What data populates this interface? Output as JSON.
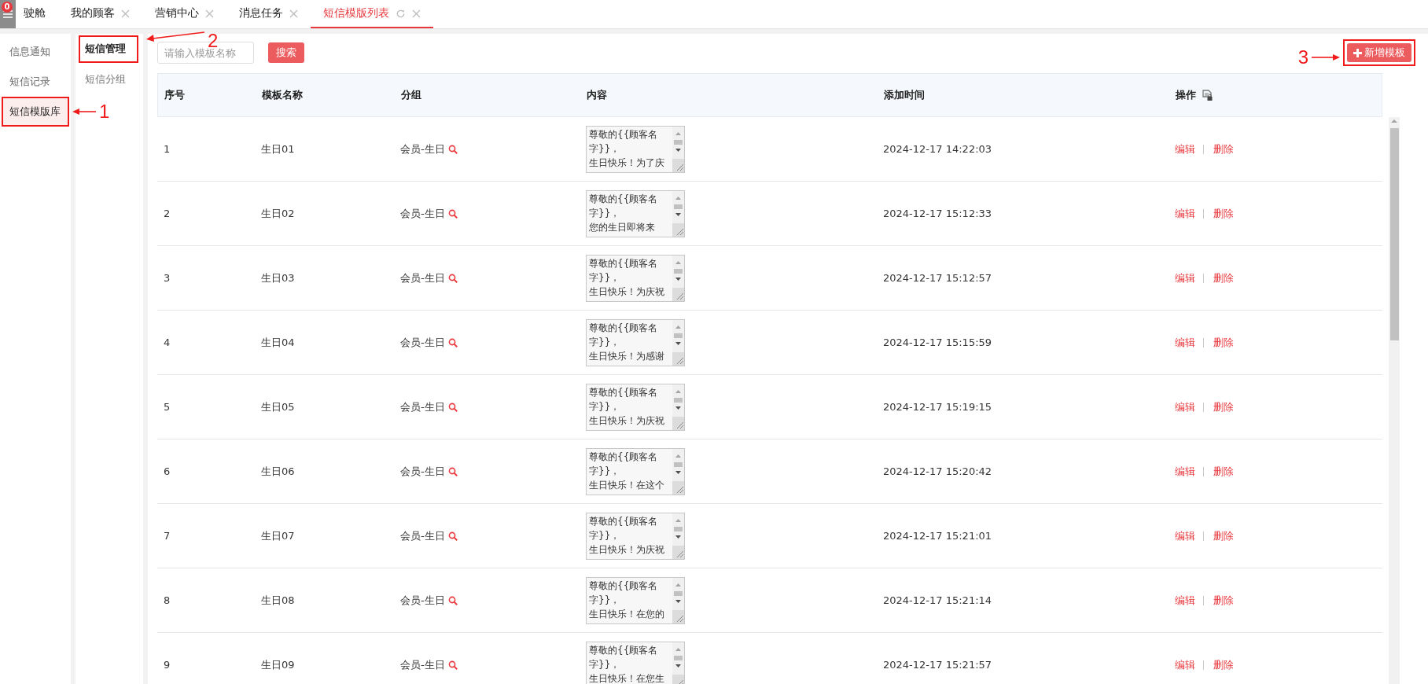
{
  "menu_badge": "0",
  "tabs": [
    {
      "label": "驶舱",
      "selected": false,
      "closable": false
    },
    {
      "label": "我的顾客",
      "selected": false,
      "closable": true
    },
    {
      "label": "营销中心",
      "selected": false,
      "closable": true
    },
    {
      "label": "消息任务",
      "selected": false,
      "closable": true
    },
    {
      "label": "短信模版列表",
      "selected": true,
      "closable": true
    }
  ],
  "sidebar": {
    "items": [
      {
        "label": "信息通知",
        "selected": false
      },
      {
        "label": "短信记录",
        "selected": false
      },
      {
        "label": "短信模版库",
        "selected": true,
        "callout": "1"
      }
    ]
  },
  "subnav": {
    "items": [
      {
        "label": "短信管理",
        "selected": true,
        "callout": "2"
      },
      {
        "label": "短信分组",
        "selected": false
      }
    ]
  },
  "search": {
    "placeholder": "请输入模板名称",
    "button": "搜索"
  },
  "add_button": {
    "label": "新增模板",
    "callout": "3"
  },
  "table": {
    "columns": [
      "序号",
      "模板名称",
      "分组",
      "内容",
      "添加时间",
      "操作"
    ],
    "rows": [
      {
        "index": "1",
        "name": "生日01",
        "group": "会员-生日",
        "content": [
          "尊敬的{{顾客名字}}，",
          "生日快乐！为了庆"
        ],
        "time": "2024-12-17 14:22:03",
        "actions": [
          "编辑",
          "删除"
        ]
      },
      {
        "index": "2",
        "name": "生日02",
        "group": "会员-生日",
        "content": [
          "尊敬的{{顾客名字}}，",
          "您的生日即将来"
        ],
        "time": "2024-12-17 15:12:33",
        "actions": [
          "编辑",
          "删除"
        ]
      },
      {
        "index": "3",
        "name": "生日03",
        "group": "会员-生日",
        "content": [
          "尊敬的{{顾客名字}}，",
          "生日快乐！为庆祝"
        ],
        "time": "2024-12-17 15:12:57",
        "actions": [
          "编辑",
          "删除"
        ]
      },
      {
        "index": "4",
        "name": "生日04",
        "group": "会员-生日",
        "content": [
          "尊敬的{{顾客名字}}，",
          "生日快乐！为感谢"
        ],
        "time": "2024-12-17 15:15:59",
        "actions": [
          "编辑",
          "删除"
        ]
      },
      {
        "index": "5",
        "name": "生日05",
        "group": "会员-生日",
        "content": [
          "尊敬的{{顾客名字}}，",
          "生日快乐！为庆祝"
        ],
        "time": "2024-12-17 15:19:15",
        "actions": [
          "编辑",
          "删除"
        ]
      },
      {
        "index": "6",
        "name": "生日06",
        "group": "会员-生日",
        "content": [
          "尊敬的{{顾客名字}}，",
          "生日快乐！在这个"
        ],
        "time": "2024-12-17 15:20:42",
        "actions": [
          "编辑",
          "删除"
        ]
      },
      {
        "index": "7",
        "name": "生日07",
        "group": "会员-生日",
        "content": [
          "尊敬的{{顾客名字}}，",
          "生日快乐！为庆祝"
        ],
        "time": "2024-12-17 15:21:01",
        "actions": [
          "编辑",
          "删除"
        ]
      },
      {
        "index": "8",
        "name": "生日08",
        "group": "会员-生日",
        "content": [
          "尊敬的{{顾客名字}}，",
          "生日快乐！在您的"
        ],
        "time": "2024-12-17 15:21:14",
        "actions": [
          "编辑",
          "删除"
        ]
      },
      {
        "index": "9",
        "name": "生日09",
        "group": "会员-生日",
        "content": [
          "尊敬的{{顾客名字}}，",
          "生日快乐！在您生"
        ],
        "time": "2024-12-17 15:21:57",
        "actions": [
          "编辑",
          "删除"
        ]
      }
    ]
  }
}
